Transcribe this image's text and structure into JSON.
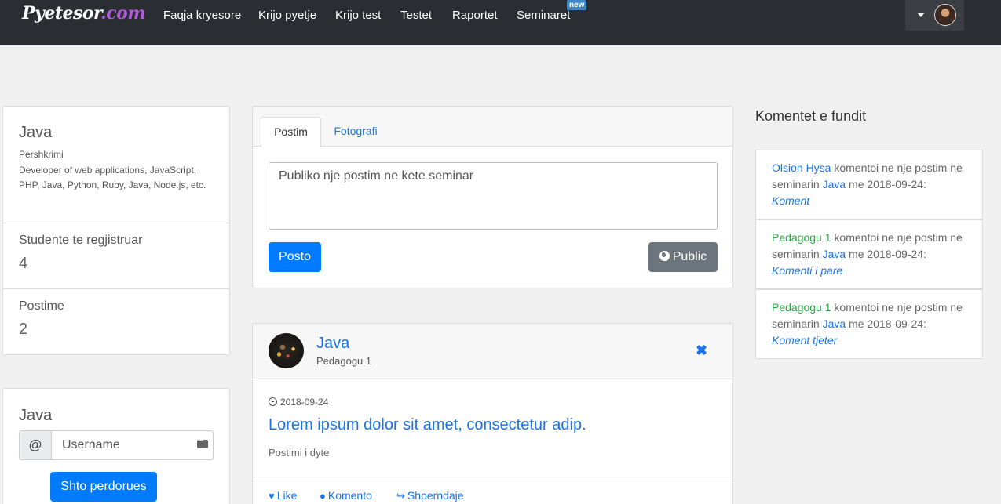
{
  "navbar": {
    "brand_main": "Pyetesor",
    "brand_suffix": ".com",
    "links": [
      "Faqja kryesore",
      "Krijo pyetje",
      "Krijo test",
      "Testet",
      "Raportet",
      "Seminaret"
    ],
    "new_badge": "new"
  },
  "seminar_info": {
    "title": "Java",
    "description_label": "Pershkrimi",
    "description": "Developer of web applications, JavaScript, PHP, Java, Python, Ruby, Java, Node.js, etc.",
    "students_label": "Studente te regjistruar",
    "students_count": "4",
    "posts_label": "Postime",
    "posts_count": "2"
  },
  "add_user": {
    "title": "Java",
    "addon": "@",
    "placeholder": "Username",
    "button": "Shto perdorues"
  },
  "composer": {
    "tabs": [
      "Postim",
      "Fotografi"
    ],
    "placeholder": "Publiko nje postim ne kete seminar",
    "post_button": "Posto",
    "visibility_button": "Public"
  },
  "post": {
    "seminar": "Java",
    "author": "Pedagogu 1",
    "date": "2018-09-24",
    "heading": "Lorem ipsum dolor sit amet, consectetur adip.",
    "body": "Postimi i dyte",
    "actions": [
      "Like",
      "Komento",
      "Shperndaje"
    ]
  },
  "recent_comments": {
    "heading": "Komentet e fundit",
    "items": [
      {
        "user": "Olsion Hysa",
        "text": " komentoi ne nje postim ne seminarin ",
        "seminar": "Java",
        "date_text": " me 2018-09-24:",
        "comment": "Koment"
      },
      {
        "user": "Pedagogu 1",
        "text": " komentoi ne nje postim ne seminarin ",
        "seminar": "Java",
        "date_text": " me 2018-09-24:",
        "comment": "Komenti i pare"
      },
      {
        "user": "Pedagogu 1",
        "text": " komentoi ne nje postim ne seminarin ",
        "seminar": "Java",
        "date_text": " me 2018-09-24:",
        "comment": "Koment tjeter"
      }
    ]
  },
  "colors": {
    "navbar_bg": "#2a2d31",
    "primary": "#007bff",
    "link": "#1a73e8",
    "secondary": "#6c757d",
    "green_user": "#28a745",
    "brand_accent": "#b25ad9"
  }
}
